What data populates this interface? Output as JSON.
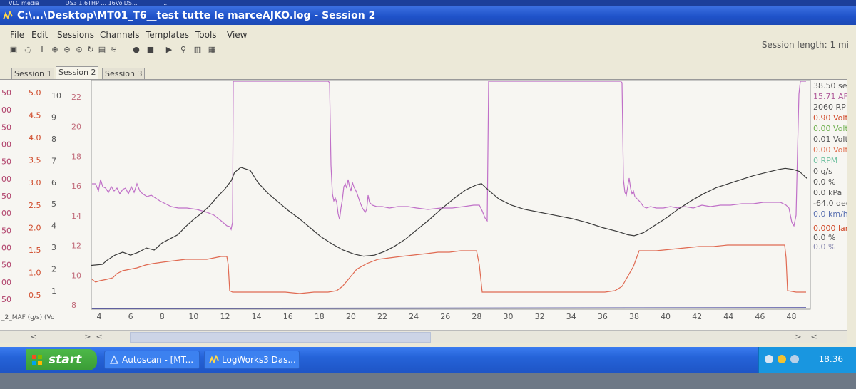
{
  "top_strip": [
    "VLC media",
    "DS3 1.6THP ... 16VolDS...",
    "..."
  ],
  "window": {
    "title": "C:\\...\\Desktop\\MT01_T6__test tutte le marceAJKO.log - Session 2"
  },
  "menu": [
    "File",
    "Edit",
    "Sessions",
    "Channels",
    "Templates",
    "Tools",
    "View"
  ],
  "session_length": "Session length: 1 mi",
  "tabs": [
    "Session 1",
    "Session 2",
    "Session 3"
  ],
  "active_tab": 1,
  "chart_data": {
    "type": "line",
    "x_axis": {
      "range": [
        3.5,
        49.2
      ],
      "ticks": [
        4,
        6,
        8,
        10,
        12,
        14,
        16,
        18,
        20,
        22,
        24,
        26,
        28,
        30,
        32,
        34,
        36,
        38,
        40,
        42,
        44,
        46,
        48
      ]
    },
    "y_axis_labels": [
      {
        "values": [
          "50",
          "00",
          "50",
          "00",
          "50",
          "00",
          "50",
          "00",
          "50",
          "00",
          "50",
          "00",
          "50"
        ],
        "color": "#b0406a"
      },
      {
        "values": [
          "5.0",
          "4.5",
          "4.0",
          "3.5",
          "3.0",
          "2.5",
          "2.0",
          "1.5",
          "1.0",
          "0.5"
        ],
        "color": "#d04a2a"
      },
      {
        "values": [
          "10",
          "9",
          "8",
          "7",
          "6",
          "5",
          "4",
          "3",
          "2",
          "1"
        ],
        "color": "#555555"
      },
      {
        "values": [
          "22",
          "20",
          "18",
          "16",
          "14",
          "12",
          "10",
          "8"
        ],
        "color": "#c06878"
      }
    ],
    "axis_caption": "_2_MAF (g/s) (Vo",
    "series": [
      {
        "color": "#9a2aa8",
        "points": [
          [
            3.5,
            395
          ],
          [
            4.2,
            396
          ],
          [
            4.5,
            400
          ],
          [
            5,
            405
          ],
          [
            5.5,
            408
          ],
          [
            6,
            405
          ],
          [
            6.5,
            408
          ],
          [
            7,
            412
          ],
          [
            7.5,
            410
          ],
          [
            8,
            417
          ],
          [
            8.5,
            421
          ],
          [
            9,
            425
          ],
          [
            9.5,
            433
          ],
          [
            10,
            440
          ],
          [
            10.5,
            446
          ],
          [
            11,
            453
          ],
          [
            11.5,
            462
          ],
          [
            12,
            470
          ],
          [
            12.4,
            478
          ],
          [
            12.6,
            486
          ],
          [
            13,
            491
          ],
          [
            13.6,
            488
          ],
          [
            14.1,
            476
          ],
          [
            14.7,
            466
          ],
          [
            15.3,
            458
          ],
          [
            16,
            449
          ],
          [
            16.7,
            441
          ],
          [
            17.4,
            432
          ],
          [
            18.1,
            423
          ],
          [
            18.8,
            416
          ],
          [
            19.5,
            410
          ],
          [
            20.2,
            406
          ],
          [
            20.8,
            404
          ],
          [
            21.5,
            405
          ],
          [
            22.2,
            409
          ],
          [
            22.8,
            414
          ],
          [
            23.5,
            421
          ],
          [
            24.2,
            430
          ],
          [
            25,
            440
          ],
          [
            25.8,
            451
          ],
          [
            26.6,
            461
          ],
          [
            27.3,
            469
          ],
          [
            28,
            474
          ],
          [
            28.3,
            475
          ],
          [
            28.8,
            468
          ],
          [
            29.4,
            460
          ],
          [
            30.2,
            454
          ],
          [
            31,
            450
          ],
          [
            32,
            447
          ],
          [
            33,
            444
          ],
          [
            34,
            441
          ],
          [
            35,
            437
          ],
          [
            36,
            432
          ],
          [
            37,
            428
          ],
          [
            37.6,
            425
          ],
          [
            38,
            424
          ],
          [
            38.6,
            427
          ],
          [
            39.2,
            433
          ],
          [
            40,
            441
          ],
          [
            40.8,
            450
          ],
          [
            41.6,
            458
          ],
          [
            42.4,
            465
          ],
          [
            43.2,
            471
          ],
          [
            44,
            475
          ],
          [
            44.8,
            479
          ],
          [
            45.6,
            483
          ],
          [
            46.4,
            486
          ],
          [
            47.2,
            489
          ],
          [
            47.6,
            490
          ],
          [
            48.1,
            489
          ],
          [
            48.5,
            487
          ],
          [
            49,
            480
          ]
        ]
      }
    ],
    "readouts": [
      {
        "text": "38.50 se",
        "color": "#555555"
      },
      {
        "text": "15.71 AF",
        "color": "#b05a9a"
      },
      {
        "text": "2060 RP",
        "color": "#555555"
      },
      {
        "text": "0.90 Volt",
        "color": "#d04a2a"
      },
      {
        "text": "0.00 Volt",
        "color": "#70b050"
      },
      {
        "text": "0.01 Volt",
        "color": "#555555"
      },
      {
        "text": "0.00 Volt",
        "color": "#e07050"
      },
      {
        "text": "0 RPM",
        "color": "#70c0a0"
      },
      {
        "text": "0 g/s",
        "color": "#555555"
      },
      {
        "text": "0.0 %",
        "color": "#555555"
      },
      {
        "text": "0.0 kPa",
        "color": "#555555"
      },
      {
        "text": "-64.0 deg",
        "color": "#555555"
      },
      {
        "text": "0.0 km/h",
        "color": "#5a70b0"
      },
      {
        "text": "0.000 lan",
        "color": "#d04a2a"
      },
      {
        "text": "0.0 %",
        "color": "#555555"
      },
      {
        "text": "0.0 %",
        "color": "#8a8ab0"
      }
    ]
  },
  "taskbar": {
    "start_label": "start",
    "tasks": [
      "Autoscan - [MT...",
      "LogWorks3 Das..."
    ],
    "clock": "18.36"
  }
}
